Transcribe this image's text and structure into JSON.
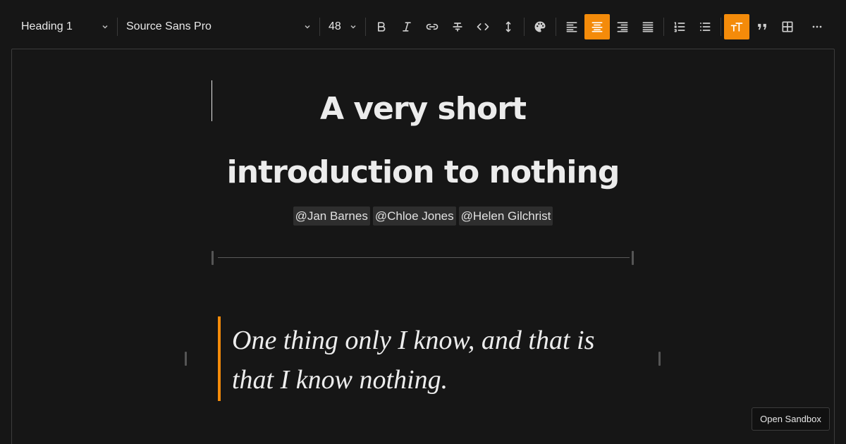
{
  "toolbar": {
    "block_style": "Heading 1",
    "font_family": "Source Sans Pro",
    "font_size": "48",
    "active_color": "#f48b0a",
    "buttons": [
      {
        "name": "bold-icon"
      },
      {
        "name": "italic-icon"
      },
      {
        "name": "link-icon"
      },
      {
        "name": "strikethrough-icon"
      },
      {
        "name": "code-icon"
      },
      {
        "name": "line-height-icon"
      },
      {
        "name": "palette-icon"
      },
      {
        "name": "align-left-icon"
      },
      {
        "name": "align-center-icon",
        "active": true
      },
      {
        "name": "align-right-icon"
      },
      {
        "name": "align-justify-icon"
      },
      {
        "name": "ordered-list-icon"
      },
      {
        "name": "bullet-list-icon"
      },
      {
        "name": "text-size-icon",
        "active": true
      },
      {
        "name": "quote-icon"
      },
      {
        "name": "table-icon"
      },
      {
        "name": "more-icon"
      }
    ]
  },
  "document": {
    "title": "A very short introduction to nothing",
    "mentions": [
      "@Jan Barnes",
      "@Chloe Jones",
      "@Helen Gilchrist"
    ],
    "quote": "One thing only I know, and that is that I know nothing."
  },
  "sandbox_button": "Open Sandbox"
}
